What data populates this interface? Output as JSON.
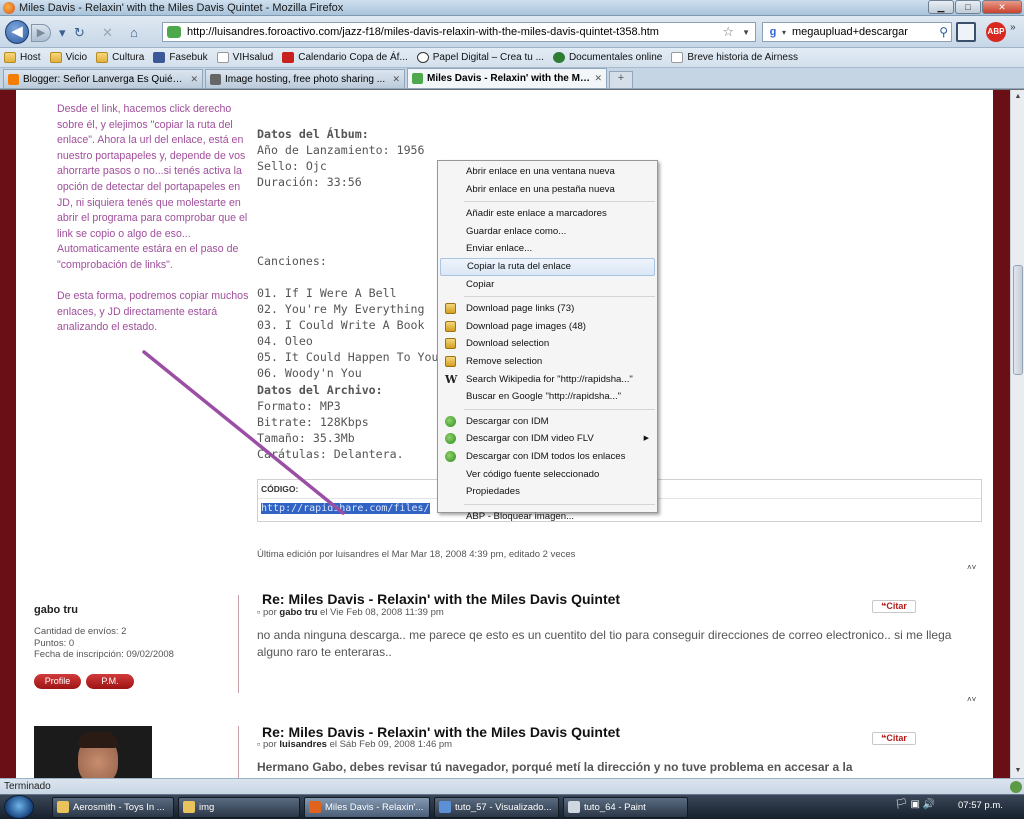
{
  "window": {
    "title": "Miles Davis - Relaxin' with the Miles Davis Quintet - Mozilla Firefox",
    "minimize": "▁",
    "maximize": "□",
    "close": "✕"
  },
  "nav": {
    "back": "◀",
    "forward": "▶",
    "url": "http://luisandres.foroactivo.com/jazz-f18/miles-davis-relaxin-with-the-miles-davis-quintet-t358.htm",
    "search_engine": "g",
    "search_value": "megaupluad+descargar",
    "abp": "ABP"
  },
  "bookmarks": [
    {
      "label": "Host",
      "icon": "folder"
    },
    {
      "label": "Vicio",
      "icon": "folder"
    },
    {
      "label": "Cultura",
      "icon": "folder"
    },
    {
      "label": "Fasebuk",
      "icon": "fb"
    },
    {
      "label": "VIHsalud",
      "icon": "page"
    },
    {
      "label": "Calendario Copa de Áf...",
      "icon": "cal"
    },
    {
      "label": "Papel Digital – Crea tu ...",
      "icon": "wp"
    },
    {
      "label": "Documentales online",
      "icon": "doc"
    },
    {
      "label": "Breve historia de Airness",
      "icon": "page"
    }
  ],
  "tabs": [
    {
      "label": "Blogger: Señor Lanverga Es Quién Y...",
      "active": false,
      "color": "#f57d00"
    },
    {
      "label": "Image hosting, free photo sharing ...",
      "active": false,
      "color": "#666666"
    },
    {
      "label": "Miles Davis - Relaxin' with the Mi...",
      "active": true,
      "color": "#4da84b"
    }
  ],
  "newtab": "+",
  "note": {
    "para1": "Desde el link, hacemos click derecho sobre él, y elejimos \"copiar la ruta del enlace\". Ahora la url del enlace, está en nuestro portapapeles y, depende de vos ahorrarte pasos o no...si tenés activa la opción de detectar del portapapeles en JD, ni siquiera tenés que molestarte en abrir el programa para comprobar que el link se copio o algo de eso... Automaticamente estára en el paso de \"comprobación de links\".",
    "para2": "De esta forma, podremos copiar muchos enlaces, y JD directamente estará analizando el estado."
  },
  "album": {
    "heading": "Datos del Álbum:",
    "lines": [
      "Año de Lanzamiento: 1956",
      "Sello: Ojc",
      "Duración: 33:56"
    ]
  },
  "songs": {
    "heading": "Canciones:",
    "items": [
      "01. If I Were A Bell",
      "02. You're My Everything",
      "03. I Could Write A Book",
      "04. Oleo",
      "05. It Could Happen To You",
      "06. Woody'n You"
    ]
  },
  "archive": {
    "heading": "Datos del Archivo:",
    "lines": [
      "Formato: MP3",
      "Bitrate: 128Kbps",
      "Tamaño: 35.3Mb",
      "Carátulas: Delantera."
    ]
  },
  "code": {
    "label": "CÓDIGO:",
    "text": "http://rapidshare.com/files/"
  },
  "edited": "Última edición por luisandres el Mar Mar 18, 2008 4:39 pm, editado 2 veces",
  "updown": "˄˅",
  "posts": [
    {
      "author": "gabo tru",
      "stats": [
        "Cantidad de envíos: 2",
        "Puntos: 0",
        "Fecha de inscripción: 09/02/2008"
      ],
      "profile": "Profile",
      "pm": "P.M.",
      "title": "Re: Miles Davis - Relaxin' with the Miles Davis Quintet",
      "meta_prefix": "por",
      "meta_author": "gabo tru",
      "meta_date": "el Vie Feb 08, 2008 11:39 pm",
      "quote": "Citar",
      "body": "no anda ninguna descarga.. me parece qe esto es un cuentito del tio para conseguir direcciones de correo electronico.. si me llega alguno raro te enteraras.."
    },
    {
      "title": "Re: Miles Davis - Relaxin' with the Miles Davis Quintet",
      "meta_prefix": "por",
      "meta_author": "luisandres",
      "meta_date": "el Sáb Feb 09, 2008 1:46 pm",
      "quote": "Citar",
      "body": "Hermano Gabo, debes revisar tú navegador, porqué metí la dirección y no tuve problema en accesar a la"
    }
  ],
  "context_menu": {
    "groups": [
      [
        {
          "label": "Abrir enlace en una ventana nueva"
        },
        {
          "label": "Abrir enlace en una pestaña nueva"
        }
      ],
      [
        {
          "label": "Añadir este enlace a marcadores"
        },
        {
          "label": "Guardar enlace como..."
        },
        {
          "label": "Enviar enlace..."
        },
        {
          "label": "Copiar la ruta del enlace",
          "highlighted": true
        },
        {
          "label": "Copiar"
        }
      ],
      [
        {
          "label": "Download page links (73)",
          "icon": "jd"
        },
        {
          "label": "Download page images (48)",
          "icon": "jd"
        },
        {
          "label": "Download selection",
          "icon": "jd"
        },
        {
          "label": "Remove selection",
          "icon": "jd"
        },
        {
          "label": "Search Wikipedia for \"http://rapidsha...\"",
          "icon": "wk"
        },
        {
          "label": "Buscar en Google \"http://rapidsha...\""
        }
      ],
      [
        {
          "label": "Descargar con IDM",
          "icon": "idm"
        },
        {
          "label": "Descargar con IDM video FLV",
          "icon": "idm",
          "submenu": true
        },
        {
          "label": "Descargar con IDM todos los enlaces",
          "icon": "idm"
        },
        {
          "label": "Ver código fuente seleccionado"
        },
        {
          "label": "Propiedades"
        }
      ],
      [
        {
          "label": "ABP - Bloquear imagen..."
        }
      ]
    ]
  },
  "status": "Terminado",
  "taskbar": {
    "items": [
      {
        "label": "Aerosmith - Toys In ...",
        "color": "#e8c25a",
        "active": false
      },
      {
        "label": "img",
        "color": "#e8c25a",
        "active": false
      },
      {
        "label": "Miles Davis - Relaxin'...",
        "color": "#e0621c",
        "active": true
      },
      {
        "label": "tuto_57 - Visualizado...",
        "color": "#5b8fd6",
        "active": false
      },
      {
        "label": "tuto_64 - Paint",
        "color": "#cfd7e1",
        "active": false
      }
    ],
    "tray": "🏳 ▣ 🔊",
    "clock": "07:57 p.m."
  }
}
